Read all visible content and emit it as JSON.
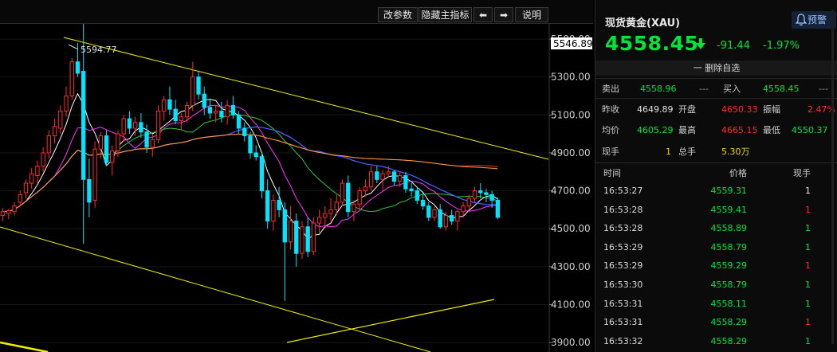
{
  "toolbar": {
    "edit_params": "改参数",
    "hide_indicators": "隐藏主指标",
    "left_arrow": "⬅",
    "right_arrow": "➡",
    "help": "说明"
  },
  "chart_data": {
    "type": "candlestick",
    "symbol": "XAU",
    "last_price_tag": "5546.89",
    "high_label": "5594.77",
    "y_ticks": [
      "5500.00",
      "5300.00",
      "5100.00",
      "4900.00",
      "4700.00",
      "4500.00",
      "4300.00",
      "4100.00",
      "3900.00"
    ],
    "ylim": [
      3850,
      5580
    ],
    "candles": [
      {
        "o": 4570,
        "h": 4610,
        "l": 4540,
        "c": 4590
      },
      {
        "o": 4580,
        "h": 4605,
        "l": 4550,
        "c": 4595
      },
      {
        "o": 4590,
        "h": 4640,
        "l": 4570,
        "c": 4620
      },
      {
        "o": 4640,
        "h": 4700,
        "l": 4620,
        "c": 4680
      },
      {
        "o": 4690,
        "h": 4760,
        "l": 4660,
        "c": 4740
      },
      {
        "o": 4740,
        "h": 4820,
        "l": 4710,
        "c": 4790
      },
      {
        "o": 4780,
        "h": 4860,
        "l": 4740,
        "c": 4830
      },
      {
        "o": 4830,
        "h": 4930,
        "l": 4800,
        "c": 4900
      },
      {
        "o": 4900,
        "h": 5020,
        "l": 4870,
        "c": 4990
      },
      {
        "o": 4990,
        "h": 5080,
        "l": 4950,
        "c": 5040
      },
      {
        "o": 5030,
        "h": 5150,
        "l": 5000,
        "c": 5120
      },
      {
        "o": 5120,
        "h": 5250,
        "l": 5090,
        "c": 5200
      },
      {
        "o": 5200,
        "h": 5400,
        "l": 5180,
        "c": 5380
      },
      {
        "o": 5380,
        "h": 5480,
        "l": 5300,
        "c": 5320
      },
      {
        "o": 5330,
        "h": 5594.77,
        "l": 4420,
        "c": 4760
      },
      {
        "o": 4760,
        "h": 4870,
        "l": 4560,
        "c": 4640
      },
      {
        "o": 4650,
        "h": 4960,
        "l": 4610,
        "c": 4920
      },
      {
        "o": 4920,
        "h": 5010,
        "l": 4870,
        "c": 4990
      },
      {
        "o": 4990,
        "h": 5020,
        "l": 4830,
        "c": 4850
      },
      {
        "o": 4850,
        "h": 4940,
        "l": 4780,
        "c": 4910
      },
      {
        "o": 4910,
        "h": 5020,
        "l": 4880,
        "c": 5000
      },
      {
        "o": 5000,
        "h": 5100,
        "l": 4960,
        "c": 5080
      },
      {
        "o": 5080,
        "h": 5120,
        "l": 5000,
        "c": 5030
      },
      {
        "o": 5030,
        "h": 5090,
        "l": 4990,
        "c": 5060
      },
      {
        "o": 5060,
        "h": 5110,
        "l": 4980,
        "c": 5010
      },
      {
        "o": 5010,
        "h": 5050,
        "l": 4900,
        "c": 4930
      },
      {
        "o": 4930,
        "h": 5000,
        "l": 4880,
        "c": 4970
      },
      {
        "o": 4970,
        "h": 5150,
        "l": 4950,
        "c": 5120
      },
      {
        "o": 5120,
        "h": 5200,
        "l": 5070,
        "c": 5180
      },
      {
        "o": 5180,
        "h": 5250,
        "l": 5100,
        "c": 5130
      },
      {
        "o": 5130,
        "h": 5180,
        "l": 5050,
        "c": 5070
      },
      {
        "o": 5070,
        "h": 5110,
        "l": 5020,
        "c": 5090
      },
      {
        "o": 5090,
        "h": 5170,
        "l": 5060,
        "c": 5150
      },
      {
        "o": 5150,
        "h": 5380,
        "l": 5120,
        "c": 5300
      },
      {
        "o": 5300,
        "h": 5330,
        "l": 5180,
        "c": 5210
      },
      {
        "o": 5210,
        "h": 5250,
        "l": 5100,
        "c": 5140
      },
      {
        "o": 5140,
        "h": 5180,
        "l": 5080,
        "c": 5110
      },
      {
        "o": 5110,
        "h": 5150,
        "l": 5060,
        "c": 5120
      },
      {
        "o": 5120,
        "h": 5170,
        "l": 5060,
        "c": 5090
      },
      {
        "o": 5090,
        "h": 5180,
        "l": 5050,
        "c": 5150
      },
      {
        "o": 5150,
        "h": 5200,
        "l": 5080,
        "c": 5100
      },
      {
        "o": 5100,
        "h": 5120,
        "l": 5000,
        "c": 5030
      },
      {
        "o": 5030,
        "h": 5060,
        "l": 4960,
        "c": 4990
      },
      {
        "o": 4990,
        "h": 5010,
        "l": 4870,
        "c": 4900
      },
      {
        "o": 4900,
        "h": 4940,
        "l": 4860,
        "c": 4880
      },
      {
        "o": 4880,
        "h": 4900,
        "l": 4660,
        "c": 4700
      },
      {
        "o": 4700,
        "h": 4760,
        "l": 4500,
        "c": 4540
      },
      {
        "o": 4540,
        "h": 4680,
        "l": 4490,
        "c": 4650
      },
      {
        "o": 4650,
        "h": 4720,
        "l": 4560,
        "c": 4600
      },
      {
        "o": 4600,
        "h": 4640,
        "l": 4120,
        "c": 4430
      },
      {
        "o": 4430,
        "h": 4620,
        "l": 4390,
        "c": 4540
      },
      {
        "o": 4540,
        "h": 4580,
        "l": 4300,
        "c": 4370
      },
      {
        "o": 4370,
        "h": 4540,
        "l": 4340,
        "c": 4510
      },
      {
        "o": 4510,
        "h": 4560,
        "l": 4350,
        "c": 4380
      },
      {
        "o": 4380,
        "h": 4560,
        "l": 4360,
        "c": 4530
      },
      {
        "o": 4530,
        "h": 4600,
        "l": 4480,
        "c": 4560
      },
      {
        "o": 4560,
        "h": 4620,
        "l": 4500,
        "c": 4580
      },
      {
        "o": 4580,
        "h": 4660,
        "l": 4540,
        "c": 4600
      },
      {
        "o": 4600,
        "h": 4680,
        "l": 4570,
        "c": 4640
      },
      {
        "o": 4640,
        "h": 4760,
        "l": 4620,
        "c": 4740
      },
      {
        "o": 4740,
        "h": 4780,
        "l": 4560,
        "c": 4590
      },
      {
        "o": 4590,
        "h": 4650,
        "l": 4540,
        "c": 4630
      },
      {
        "o": 4630,
        "h": 4720,
        "l": 4600,
        "c": 4700
      },
      {
        "o": 4700,
        "h": 4760,
        "l": 4670,
        "c": 4720
      },
      {
        "o": 4720,
        "h": 4830,
        "l": 4700,
        "c": 4800
      },
      {
        "o": 4800,
        "h": 4830,
        "l": 4740,
        "c": 4760
      },
      {
        "o": 4760,
        "h": 4810,
        "l": 4700,
        "c": 4790
      },
      {
        "o": 4790,
        "h": 4830,
        "l": 4770,
        "c": 4800
      },
      {
        "o": 4800,
        "h": 4810,
        "l": 4730,
        "c": 4750
      },
      {
        "o": 4750,
        "h": 4800,
        "l": 4720,
        "c": 4780
      },
      {
        "o": 4780,
        "h": 4800,
        "l": 4690,
        "c": 4710
      },
      {
        "o": 4710,
        "h": 4740,
        "l": 4670,
        "c": 4700
      },
      {
        "o": 4700,
        "h": 4720,
        "l": 4630,
        "c": 4650
      },
      {
        "o": 4650,
        "h": 4690,
        "l": 4600,
        "c": 4620
      },
      {
        "o": 4620,
        "h": 4640,
        "l": 4540,
        "c": 4560
      },
      {
        "o": 4560,
        "h": 4620,
        "l": 4540,
        "c": 4600
      },
      {
        "o": 4600,
        "h": 4630,
        "l": 4500,
        "c": 4510
      },
      {
        "o": 4510,
        "h": 4590,
        "l": 4490,
        "c": 4570
      },
      {
        "o": 4570,
        "h": 4600,
        "l": 4520,
        "c": 4540
      },
      {
        "o": 4540,
        "h": 4600,
        "l": 4490,
        "c": 4590
      },
      {
        "o": 4590,
        "h": 4640,
        "l": 4560,
        "c": 4620
      },
      {
        "o": 4620,
        "h": 4680,
        "l": 4600,
        "c": 4660
      },
      {
        "o": 4660,
        "h": 4720,
        "l": 4640,
        "c": 4700
      },
      {
        "o": 4700,
        "h": 4740,
        "l": 4660,
        "c": 4690
      },
      {
        "o": 4690,
        "h": 4710,
        "l": 4640,
        "c": 4680
      },
      {
        "o": 4680,
        "h": 4700,
        "l": 4610,
        "c": 4650
      },
      {
        "o": 4650,
        "h": 4665,
        "l": 4550,
        "c": 4560
      }
    ]
  },
  "quote": {
    "title": "现货黄金(XAU)",
    "alert_label": "预警",
    "price": "4558.45",
    "change": "-91.44",
    "change_pct": "-1.97%",
    "remove_label": "一 删除自选",
    "sell_label": "卖出",
    "sell_price": "4558.96",
    "sell_vol": "---",
    "buy_label": "买入",
    "buy_price": "4558.45",
    "buy_vol": "---",
    "prev_close_label": "昨收",
    "prev_close": "4649.89",
    "open_label": "开盘",
    "open": "4650.33",
    "amplitude_label": "振幅",
    "amplitude": "2.47%",
    "avg_label": "均价",
    "avg": "4605.29",
    "high_label": "最高",
    "high": "4665.15",
    "low_label": "最低",
    "low": "4550.37",
    "cur_vol_label": "现手",
    "cur_vol": "1",
    "total_vol_label": "总手",
    "total_vol": "5.30万"
  },
  "ticks": {
    "headers": {
      "time": "时间",
      "price": "价格",
      "volume": "现手"
    },
    "rows": [
      {
        "time": "16:53:27",
        "price": "4559.31",
        "vol": "1",
        "vol_color": "#e6e6e6"
      },
      {
        "time": "16:53:28",
        "price": "4559.41",
        "vol": "1",
        "vol_color": "#ff2b2b"
      },
      {
        "time": "16:53:28",
        "price": "4558.89",
        "vol": "1",
        "vol_color": "#00e53c"
      },
      {
        "time": "16:53:29",
        "price": "4558.79",
        "vol": "1",
        "vol_color": "#00e53c"
      },
      {
        "time": "16:53:29",
        "price": "4559.29",
        "vol": "1",
        "vol_color": "#ff2b2b"
      },
      {
        "time": "16:53:30",
        "price": "4558.79",
        "vol": "1",
        "vol_color": "#00e53c"
      },
      {
        "time": "16:53:31",
        "price": "4558.11",
        "vol": "1",
        "vol_color": "#00e53c"
      },
      {
        "time": "16:53:31",
        "price": "4558.29",
        "vol": "1",
        "vol_color": "#ff2b2b"
      },
      {
        "time": "16:53:32",
        "price": "4558.29",
        "vol": "1",
        "vol_color": "#00e53c"
      }
    ]
  },
  "colors": {
    "up": "#ff2b2b",
    "down": "#00e5ff",
    "price_green": "#00e53c",
    "trendline": "#f2f200"
  }
}
